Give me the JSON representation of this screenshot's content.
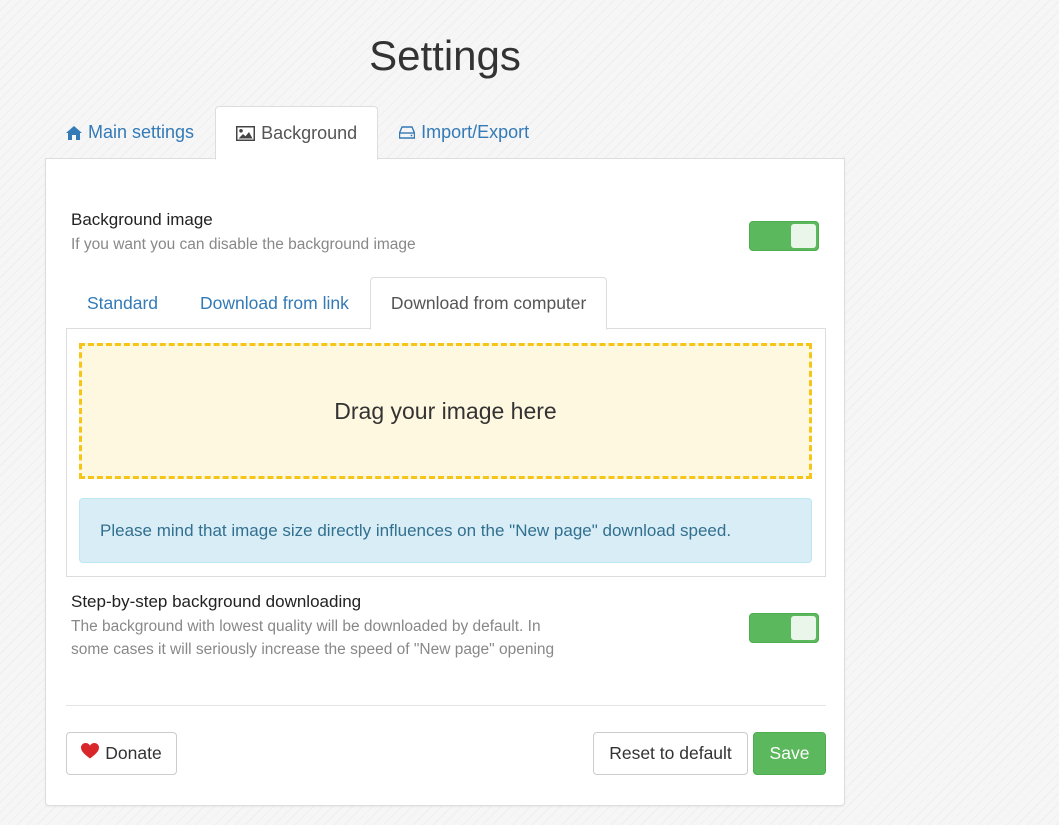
{
  "page": {
    "title": "Settings"
  },
  "main_tabs": [
    {
      "label": "Main settings",
      "icon": "home-icon",
      "active": false
    },
    {
      "label": "Background",
      "icon": "image-icon",
      "active": true
    },
    {
      "label": "Import/Export",
      "icon": "hdd-icon",
      "active": false
    }
  ],
  "background_image": {
    "title": "Background image",
    "description": "If you want you can disable the background image",
    "enabled": true
  },
  "source_tabs": [
    {
      "label": "Standard",
      "active": false
    },
    {
      "label": "Download from link",
      "active": false
    },
    {
      "label": "Download from computer",
      "active": true
    }
  ],
  "dropzone": {
    "label": "Drag your image here"
  },
  "notice": {
    "text": "Please mind that image size directly influences on the \"New page\" download speed."
  },
  "step_loading": {
    "title": "Step-by-step background downloading",
    "description_line1": "The background with lowest quality will be downloaded by default. In",
    "description_line2": "some cases it will seriously increase the speed of \"New page\" opening",
    "enabled": true
  },
  "footer": {
    "donate_label": "Donate",
    "reset_label": "Reset to default",
    "save_label": "Save"
  },
  "colors": {
    "accent_link": "#337ab7",
    "toggle_on": "#5cb85c",
    "dropzone_border": "#f5c518",
    "dropzone_bg": "#fff8e1",
    "notice_bg": "#d9edf7",
    "heart": "#d9262b"
  }
}
